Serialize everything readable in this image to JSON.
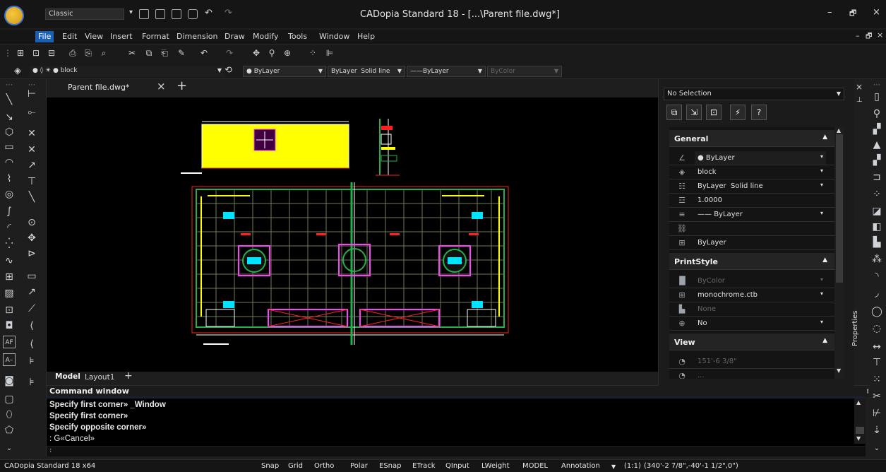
{
  "window": {
    "workspace": "Classic",
    "title": "CADopia Standard 18 - [...\\Parent file.dwg*]",
    "controls": [
      "–",
      "🗗",
      "×"
    ],
    "mdi_controls": [
      "–",
      "🗗",
      "×"
    ]
  },
  "menu": [
    "File",
    "Edit",
    "View",
    "Insert",
    "Format",
    "Dimension",
    "Draw",
    "Modify",
    "Tools",
    "Window",
    "Help"
  ],
  "layer_bar": {
    "layer": "block",
    "color": "ByLayer",
    "linetype": "ByLayer",
    "linetype_style": "Solid line",
    "lineweight": "ByLayer",
    "plotstyle": "ByColor"
  },
  "tabs": {
    "document": "Parent file.dwg*",
    "model": "Model",
    "layout1": "Layout1"
  },
  "command_window": {
    "title": "Command window",
    "lines": [
      "Specify first corner» _Window",
      "Specify first corner»",
      "Specify opposite corner»",
      ": G«Cancel»"
    ],
    "prompt": ":"
  },
  "status": {
    "left": "CADopia Standard 18 x64",
    "toggles": [
      "Snap",
      "Grid",
      "Ortho",
      "Polar",
      "ESnap",
      "ETrack",
      "QInput",
      "LWeight",
      "MODEL"
    ],
    "annotation": "Annotation",
    "scale": "(1:1)",
    "coords": "(340'-2 7/8\",-40'-1 1/2\",0\")"
  },
  "properties": {
    "panel_title": "Properties",
    "selection": "No Selection",
    "general": {
      "label": "General",
      "color": "ByLayer",
      "layer": "block",
      "linetype": "ByLayer",
      "linetype_style": "Solid line",
      "linetype_scale": "1.0000",
      "lineweight": "ByLayer",
      "hyperlink": "",
      "thickness": "ByLayer"
    },
    "printstyle": {
      "label": "PrintStyle",
      "style": "ByColor",
      "table": "monochrome.ctb",
      "attached": "None",
      "ribbon": "No"
    },
    "view": {
      "label": "View",
      "center_x": "151'-6 3/8\"",
      "center_y": "..."
    }
  },
  "colors": {
    "accent": "#1a5fb4",
    "drawing_yellow": "#ffff00",
    "drawing_green": "#22b14c",
    "drawing_red": "#ff2020",
    "drawing_magenta": "#ff00ff",
    "drawing_cyan": "#00e5ff"
  }
}
